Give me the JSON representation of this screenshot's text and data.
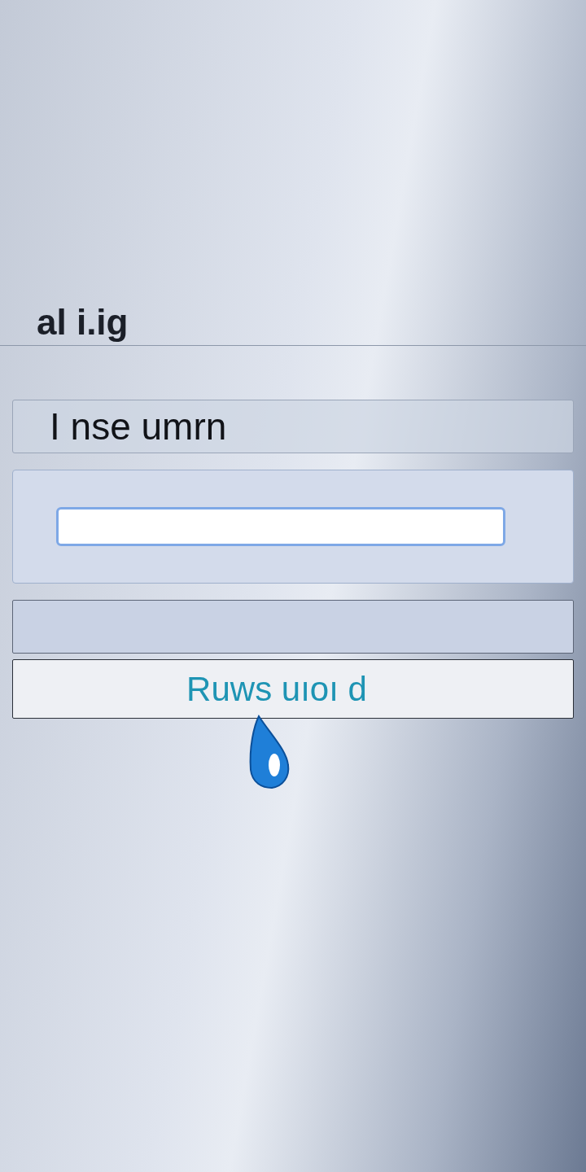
{
  "title": "al i.ig",
  "name_field": {
    "value": "I nse umrn"
  },
  "button": {
    "label": "Ruws uıoı d"
  }
}
